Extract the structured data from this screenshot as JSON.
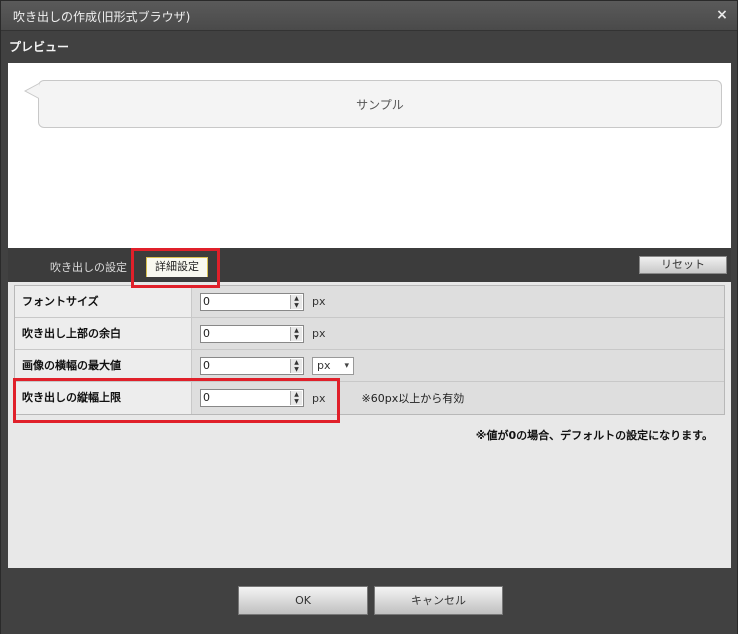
{
  "window": {
    "title": "吹き出しの作成(旧形式ブラウザ)",
    "close_label": "×"
  },
  "preview": {
    "section_label": "プレビュー",
    "bubble_text": "サンプル"
  },
  "tabs": {
    "basic_label": "吹き出しの設定",
    "detail_label": "詳細設定",
    "active": "詳細設定"
  },
  "reset_label": "リセット",
  "settings": {
    "rows": [
      {
        "label": "フォントサイズ",
        "value": "0",
        "unit": "px"
      },
      {
        "label": "吹き出し上部の余白",
        "value": "0",
        "unit": "px"
      },
      {
        "label": "画像の横幅の最大値",
        "value": "0",
        "unit_select": "px"
      },
      {
        "label": "吹き出しの縦幅上限",
        "value": "0",
        "unit": "px",
        "hint": "※60px以上から有効"
      }
    ],
    "note": "※値が0の場合、デフォルトの設定になります。"
  },
  "footer": {
    "ok_label": "OK",
    "cancel_label": "キャンセル"
  },
  "colors": {
    "highlight": "#e0202a",
    "background": "#414141"
  }
}
